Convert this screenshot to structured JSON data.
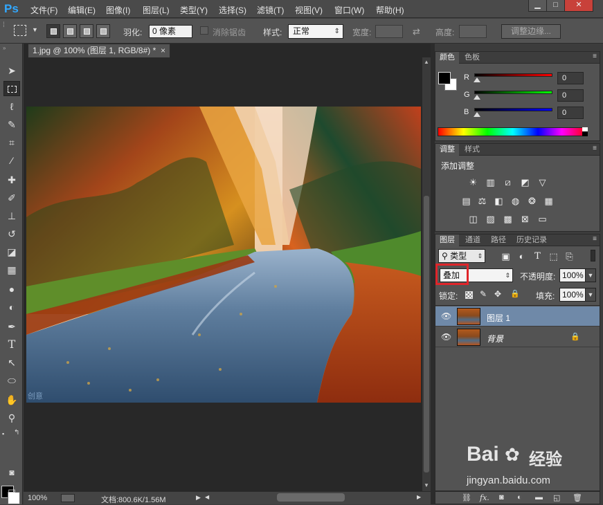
{
  "app": {
    "logo": "Ps"
  },
  "menu": [
    "文件(F)",
    "编辑(E)",
    "图像(I)",
    "图层(L)",
    "类型(Y)",
    "选择(S)",
    "滤镜(T)",
    "视图(V)",
    "窗口(W)",
    "帮助(H)"
  ],
  "window_controls": {
    "minimize": "▁",
    "maximize": "□",
    "close": "✕"
  },
  "options": {
    "feather_label": "羽化:",
    "feather_value": "0 像素",
    "antialias_label": "消除锯齿",
    "style_label": "样式:",
    "style_value": "正常",
    "width_label": "宽度:",
    "height_label": "高度:",
    "refine_button": "调整边缘..."
  },
  "document": {
    "tab_title": "1.jpg @ 100% (图层 1, RGB/8#) *",
    "tab_close": "×",
    "canvas_watermark": "创意"
  },
  "status": {
    "zoom": "100%",
    "doc_info": "文档:800.6K/1.56M"
  },
  "color_panel": {
    "tabs": [
      "颜色",
      "色板"
    ],
    "channels": [
      {
        "label": "R",
        "value": "0",
        "gradient_end": "#ff0000"
      },
      {
        "label": "G",
        "value": "0",
        "gradient_end": "#00ff00"
      },
      {
        "label": "B",
        "value": "0",
        "gradient_end": "#0000ff"
      }
    ]
  },
  "adjustments_panel": {
    "tabs": [
      "调整",
      "样式"
    ],
    "title": "添加调整"
  },
  "layers_panel": {
    "tabs": [
      "图层",
      "通道",
      "路径",
      "历史记录"
    ],
    "filter_label": "类型",
    "blend_mode": "叠加",
    "opacity_label": "不透明度:",
    "opacity_value": "100%",
    "lock_label": "锁定:",
    "fill_label": "填充:",
    "fill_value": "100%",
    "layers": [
      {
        "name": "图层 1",
        "selected": true
      },
      {
        "name": "背景",
        "selected": false
      }
    ]
  },
  "colors": {
    "accent_selection": "#6f89a8",
    "highlight_box": "#e0252a",
    "ps_blue": "#31a8ff"
  },
  "watermark": {
    "brand": "Bai",
    "brand2": "经验",
    "url": "jingyan.baidu.com"
  }
}
